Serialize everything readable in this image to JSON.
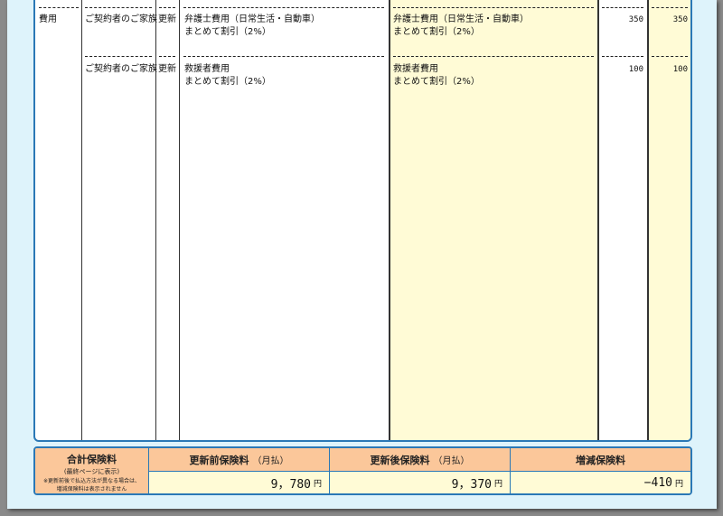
{
  "rows": [
    {
      "category": "費用",
      "insured": "ご契約者のご家族",
      "status": "更新",
      "before_coverage": "弁護士費用（日常生活・自動車）",
      "before_discount": "まとめて割引（2%）",
      "after_coverage": "弁護士費用（日常生活・自動車）",
      "after_discount": "まとめて割引（2%）",
      "before_premium": "350",
      "after_premium": "350"
    },
    {
      "category": "",
      "insured": "ご契約者のご家族",
      "status": "更新",
      "before_coverage": "救援者費用",
      "before_discount": "まとめて割引（2%）",
      "after_coverage": "救援者費用",
      "after_discount": "まとめて割引（2%）",
      "before_premium": "100",
      "after_premium": "100"
    }
  ],
  "summary": {
    "total_label": "合計保険料",
    "total_sub": "(最終ページに表示)",
    "total_note1": "※更新前後で払込方法が異なる場合は、",
    "total_note2": "増減保険料は表示されません",
    "before_label": "更新前保険料",
    "before_suffix": "（月払）",
    "after_label": "更新後保険料",
    "after_suffix": "（月払）",
    "diff_label": "増減保険料",
    "before_value": "9，780",
    "after_value": "9，370",
    "diff_value": "−410",
    "unit": "円"
  },
  "colors": {
    "frame": "#2a78b6",
    "page_bg": "#def3fb",
    "highlight": "#fffbd6",
    "header_orange": "#fbc79a"
  }
}
